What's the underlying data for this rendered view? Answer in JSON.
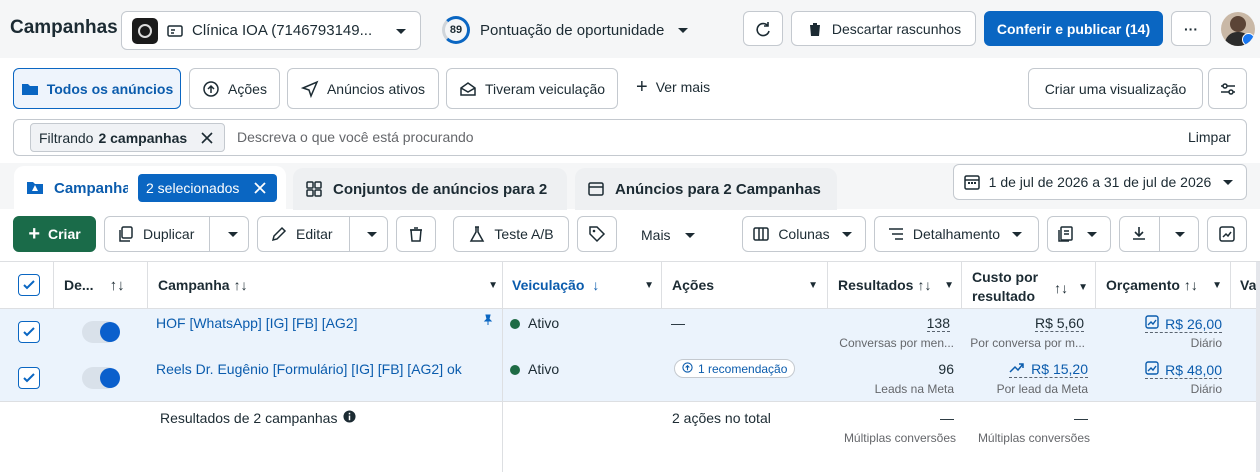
{
  "header": {
    "title": "Campanhas",
    "account": "Clínica IOA (7146793149...",
    "score": "89",
    "score_label": "Pontuação de oportunidade",
    "discard_label": "Descartar rascunhos",
    "publish_label": "Conferir e publicar (14)",
    "more_label": "···"
  },
  "viewtabs": {
    "all": "Todos os anúncios",
    "actions": "Ações",
    "active": "Anúncios ativos",
    "delivered": "Tiveram veiculação",
    "see_more": "Ver mais",
    "create_view": "Criar uma visualização"
  },
  "filter": {
    "chip_prefix": "Filtrando",
    "chip_bold": "2 campanhas",
    "placeholder": "Descreva o que você está procurando",
    "clear": "Limpar"
  },
  "leveltabs": {
    "campaigns": "Campanhas",
    "selected": "2 selecionados",
    "adsets": "Conjuntos de anúncios para 2",
    "ads": "Anúncios para 2 Campanhas",
    "daterange": "1 de jul de 2026 a 31 de jul de 2026"
  },
  "toolbar": {
    "create": "Criar",
    "duplicate": "Duplicar",
    "edit": "Editar",
    "abtest": "Teste A/B",
    "more": "Mais",
    "columns": "Colunas",
    "breakdown": "Detalhamento"
  },
  "columns": {
    "delivery_short": "De...",
    "campaign": "Campanha",
    "delivery": "Veiculação",
    "actions": "Ações",
    "results": "Resultados",
    "cost_line1": "Custo por",
    "cost_line2": "resultado",
    "budget": "Orçamento",
    "next": "Va"
  },
  "rows": [
    {
      "name": "HOF [WhatsApp] [IG] [FB] [AG2]",
      "status": "Ativo",
      "actions": "—",
      "results": "138",
      "results_sub": "Conversas por men...",
      "cost": "R$ 5,60",
      "cost_sub": "Por conversa por m...",
      "budget": "R$ 26,00",
      "budget_sub": "Diário"
    },
    {
      "name": "Reels Dr. Eugênio [Formulário] [IG] [FB] [AG2] ok",
      "status": "Ativo",
      "actions": "1 recomendação",
      "results": "96",
      "results_sub": "Leads na Meta",
      "cost": "R$ 15,20",
      "cost_sub": "Por lead da Meta",
      "budget": "R$ 48,00",
      "budget_sub": "Diário"
    }
  ],
  "summary": {
    "label": "Resultados de 2 campanhas",
    "actions": "2 ações no total",
    "results": "—",
    "results_sub": "Múltiplas conversões",
    "cost": "—",
    "cost_sub": "Múltiplas conversões"
  },
  "colors": {
    "primary": "#0a66c2",
    "create": "#1a6b49",
    "active_dot": "#1e6b45",
    "link": "#0b5cad"
  }
}
